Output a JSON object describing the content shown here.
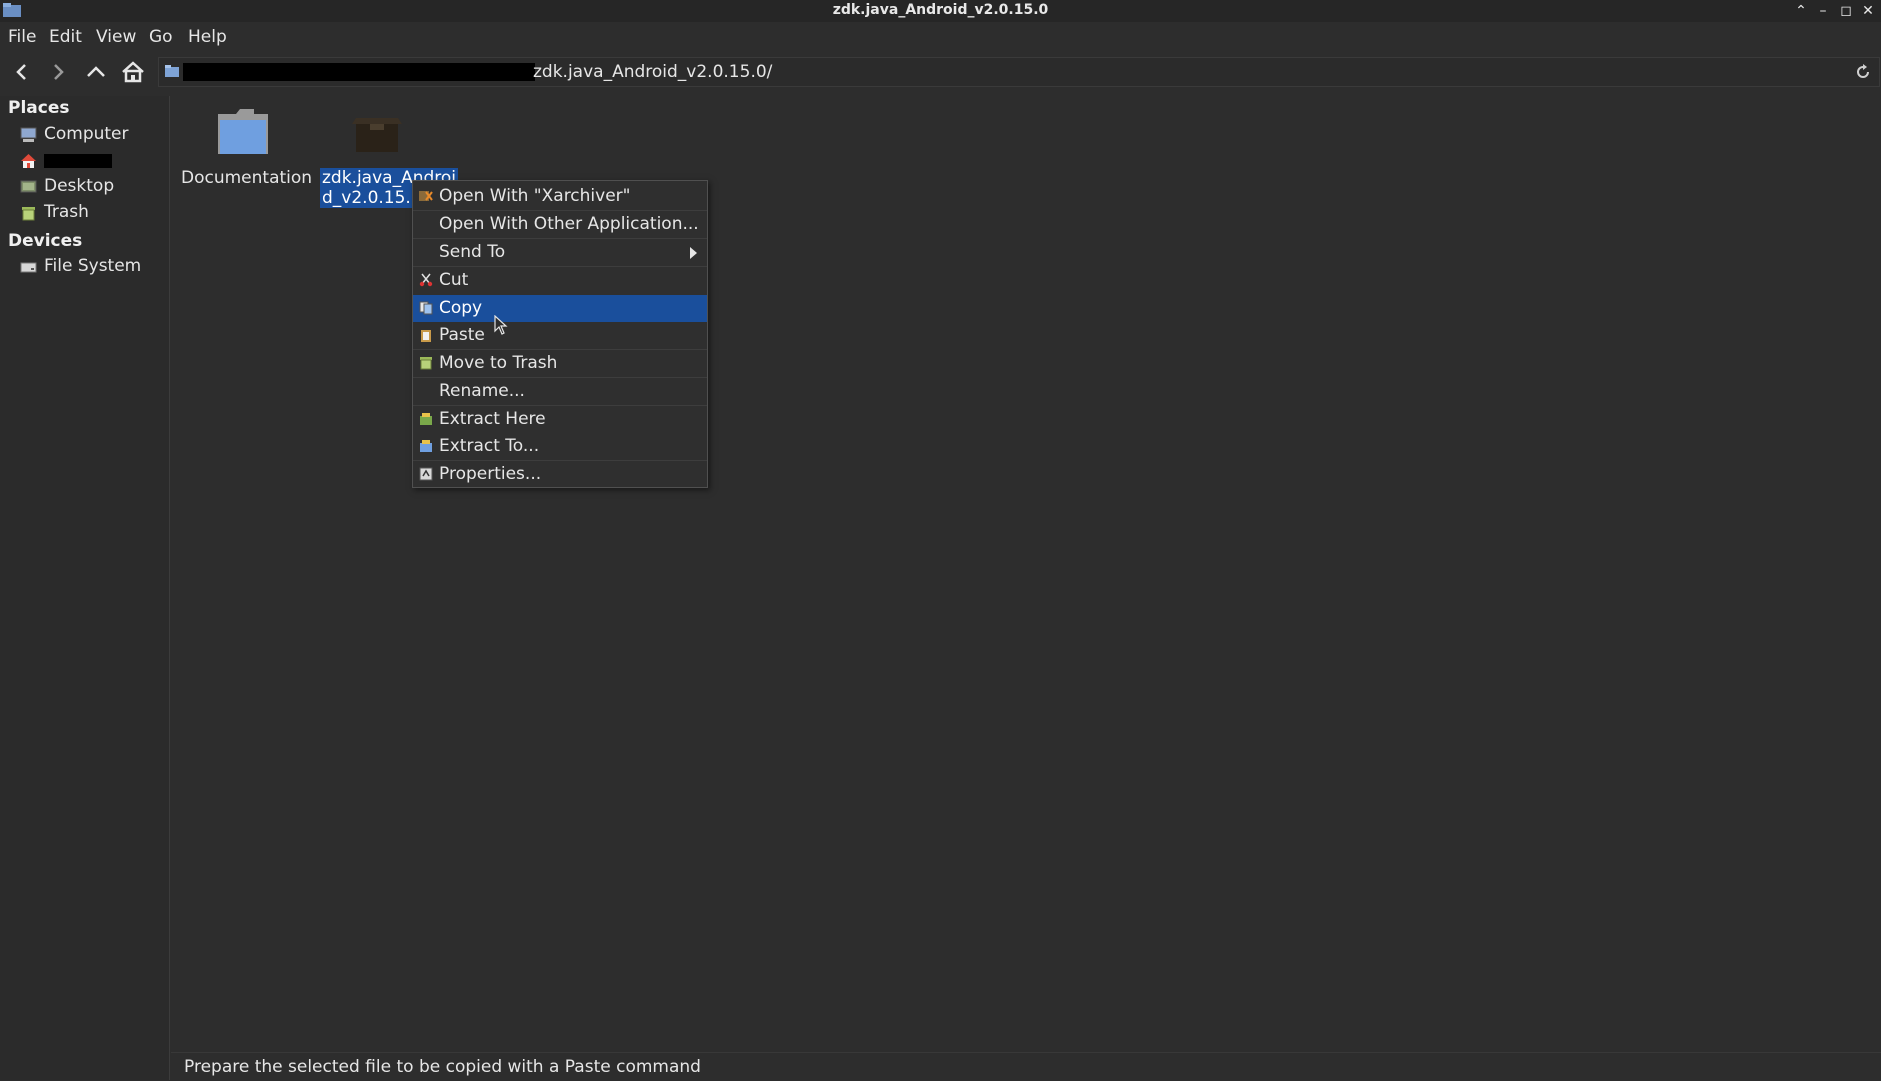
{
  "window": {
    "title": "zdk.java_Android_v2.0.15.0",
    "controls": {
      "roll_up": "⌃",
      "minimize": "–",
      "maximize": "◻",
      "close": "✕"
    }
  },
  "menubar": {
    "items": [
      "File",
      "Edit",
      "View",
      "Go",
      "Help"
    ]
  },
  "toolbar": {
    "buttons": [
      "back-arrow-icon",
      "forward-arrow-icon",
      "up-arrow-icon",
      "home-icon"
    ]
  },
  "location": {
    "path_visible": "zdk.java_Android_v2.0.15.0/"
  },
  "sidebar": {
    "places_header": "Places",
    "places": [
      {
        "label": "Computer",
        "icon": "computer-icon"
      },
      {
        "label": "",
        "icon": "home-icon",
        "redacted": true
      },
      {
        "label": "Desktop",
        "icon": "desktop-icon"
      },
      {
        "label": "Trash",
        "icon": "trash-icon"
      }
    ],
    "devices_header": "Devices",
    "devices": [
      {
        "label": "File System",
        "icon": "drive-icon"
      }
    ]
  },
  "files": [
    {
      "name": "Documentation",
      "icon": "folder-icon"
    },
    {
      "name_line1": "zdk.java_Androi",
      "name_line2": "d_v2.0.15.0",
      "icon": "archive-icon",
      "selected": true
    }
  ],
  "context_menu": {
    "items": [
      {
        "label": "Open With \"Xarchiver\"",
        "icon": "xarchiver-icon"
      },
      {
        "label": "Open With Other Application...",
        "icon": ""
      },
      {
        "label": "Send To",
        "icon": "",
        "submenu": true
      },
      {
        "label": "Cut",
        "icon": "scissors-icon"
      },
      {
        "label": "Copy",
        "icon": "copy-icon",
        "highlighted": true
      },
      {
        "label": "Paste",
        "icon": "paste-icon"
      },
      {
        "label": "Move to Trash",
        "icon": "trash-icon"
      },
      {
        "label": "Rename...",
        "icon": ""
      },
      {
        "label": "Extract Here",
        "icon": "extract-here-icon"
      },
      {
        "label": "Extract To...",
        "icon": "extract-to-icon"
      },
      {
        "label": "Properties...",
        "icon": "properties-icon"
      }
    ]
  },
  "statusbar": {
    "text": "Prepare the selected file to be copied with a Paste command"
  },
  "colors": {
    "highlight": "#1a4f9c",
    "background": "#2d2d2d",
    "text": "#e6e6e6"
  }
}
